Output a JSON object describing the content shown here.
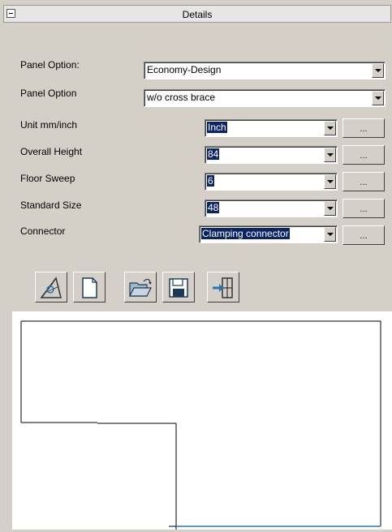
{
  "panel": {
    "title": "Details"
  },
  "form": {
    "panel_option_1": {
      "label": "Panel Option:",
      "value": "Economy-Design"
    },
    "panel_option_2": {
      "label": "Panel Option",
      "value": "w/o cross brace"
    },
    "unit": {
      "label": "Unit mm/inch",
      "value": "Inch",
      "button": "..."
    },
    "overall_height": {
      "label": "Overall Height",
      "value": "84",
      "button": "..."
    },
    "floor_sweep": {
      "label": "Floor Sweep",
      "value": "6",
      "button": "..."
    },
    "standard_size": {
      "label": "Standard Size",
      "value": "48",
      "button": "..."
    },
    "connector": {
      "label": "Connector",
      "value": "Clamping connector",
      "button": "..."
    }
  },
  "toolbar": {
    "icons": [
      "drafting-tool-icon",
      "new-document-icon",
      "open-folder-icon",
      "save-floppy-icon",
      "insert-panel-icon"
    ]
  },
  "colors": {
    "background": "#d4d0c8",
    "selection": "#0a246a",
    "canvas_line": "#000000",
    "canvas_accent_line": "#1f7ab8"
  }
}
